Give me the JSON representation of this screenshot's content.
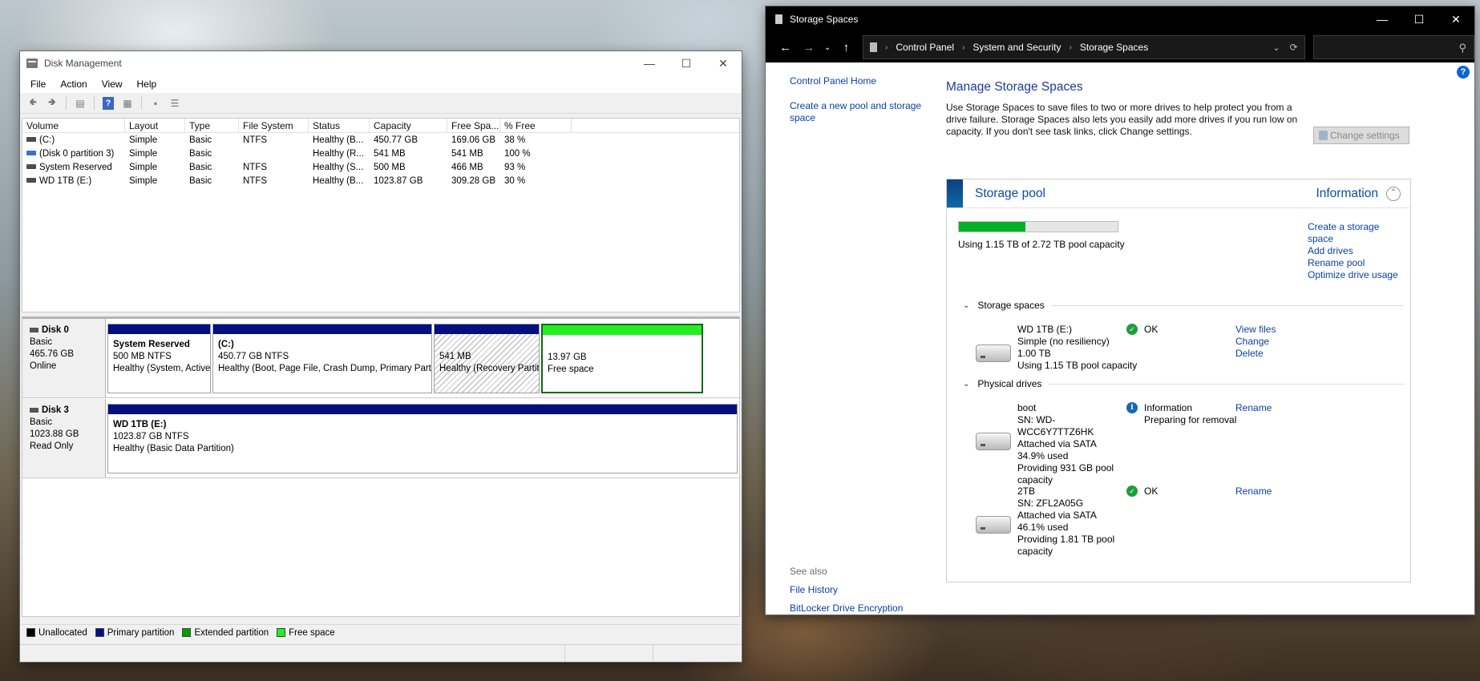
{
  "disk_mgmt": {
    "title": "Disk Management",
    "menu": [
      "File",
      "Action",
      "View",
      "Help"
    ],
    "columns": [
      "Volume",
      "Layout",
      "Type",
      "File System",
      "Status",
      "Capacity",
      "Free Spa...",
      "% Free"
    ],
    "volumes": [
      {
        "icon": "volume-icon",
        "name": "(C:)",
        "layout": "Simple",
        "type": "Basic",
        "fs": "NTFS",
        "status": "Healthy (B...",
        "capacity": "450.77 GB",
        "free": "169.06 GB",
        "pct": "38 %"
      },
      {
        "icon": "volume-blue-icon",
        "name": "(Disk 0 partition 3)",
        "layout": "Simple",
        "type": "Basic",
        "fs": "",
        "status": "Healthy (R...",
        "capacity": "541 MB",
        "free": "541 MB",
        "pct": "100 %"
      },
      {
        "icon": "volume-icon",
        "name": "System Reserved",
        "layout": "Simple",
        "type": "Basic",
        "fs": "NTFS",
        "status": "Healthy (S...",
        "capacity": "500 MB",
        "free": "466 MB",
        "pct": "93 %"
      },
      {
        "icon": "volume-icon",
        "name": "WD 1TB (E:)",
        "layout": "Simple",
        "type": "Basic",
        "fs": "NTFS",
        "status": "Healthy (B...",
        "capacity": "1023.87 GB",
        "free": "309.28 GB",
        "pct": "30 %"
      }
    ],
    "disk0": {
      "name": "Disk 0",
      "type": "Basic",
      "size": "465.76 GB",
      "state": "Online",
      "parts": [
        {
          "title": "System Reserved",
          "size": "500 MB NTFS",
          "status": "Healthy (System, Active, Primary Partition)"
        },
        {
          "title": "(C:)",
          "size": "450.77 GB NTFS",
          "status": "Healthy (Boot, Page File, Crash Dump, Primary Partition)"
        },
        {
          "title": "",
          "size": "541 MB",
          "status": "Healthy (Recovery Partition)"
        },
        {
          "title": "",
          "size": "13.97 GB",
          "status": "Free space"
        }
      ]
    },
    "disk3": {
      "name": "Disk 3",
      "type": "Basic",
      "size": "1023.88 GB",
      "state": "Read Only",
      "parts": [
        {
          "title": "WD 1TB  (E:)",
          "size": "1023.87 GB NTFS",
          "status": "Healthy (Basic Data Partition)"
        }
      ]
    },
    "legend": [
      {
        "label": "Unallocated",
        "color": "#000000"
      },
      {
        "label": "Primary partition",
        "color": "#050f80"
      },
      {
        "label": "Extended partition",
        "color": "#00a000"
      },
      {
        "label": "Free space",
        "color": "#22ee22"
      }
    ]
  },
  "storage": {
    "title": "Storage Spaces",
    "breadcrumb": [
      "Control Panel",
      "System and Security",
      "Storage Spaces"
    ],
    "left": {
      "home": "Control Panel Home",
      "create": "Create a new pool and storage space",
      "see_also": "See also",
      "links": [
        "File History",
        "BitLocker Drive Encryption"
      ]
    },
    "heading": "Manage Storage Spaces",
    "desc": "Use Storage Spaces to save files to two or more drives to help protect you from a drive failure. Storage Spaces also lets you easily add more drives if you run low on capacity. If you don't see task links, click Change settings.",
    "change_settings": "Change settings",
    "pool": {
      "title": "Storage pool",
      "info": "Information",
      "usage_fraction": 0.42,
      "usage_text": "Using 1.15 TB of 2.72 TB pool capacity",
      "links": [
        "Create a storage space",
        "Add drives",
        "Rename pool",
        "Optimize drive usage"
      ]
    },
    "spaces_label": "Storage spaces",
    "space": {
      "lines": [
        "WD 1TB (E:)",
        "Simple (no resiliency)",
        "1.00 TB",
        "Using 1.15 TB pool capacity"
      ],
      "status": "OK",
      "links": [
        "View files",
        "Change",
        "Delete"
      ]
    },
    "drives_label": "Physical drives",
    "drives": [
      {
        "lines": [
          "boot",
          "SN: WD-WCC6Y7TTZ6HK",
          "Attached via SATA",
          "34.9% used",
          "Providing 931 GB pool capacity"
        ],
        "status": "Information",
        "status2": "Preparing for removal",
        "link": "Rename"
      },
      {
        "lines": [
          "2TB",
          "SN: ZFL2A05G",
          "Attached via SATA",
          "46.1% used",
          "Providing 1.81 TB pool capacity"
        ],
        "status": "OK",
        "status2": "",
        "link": "Rename"
      }
    ]
  }
}
